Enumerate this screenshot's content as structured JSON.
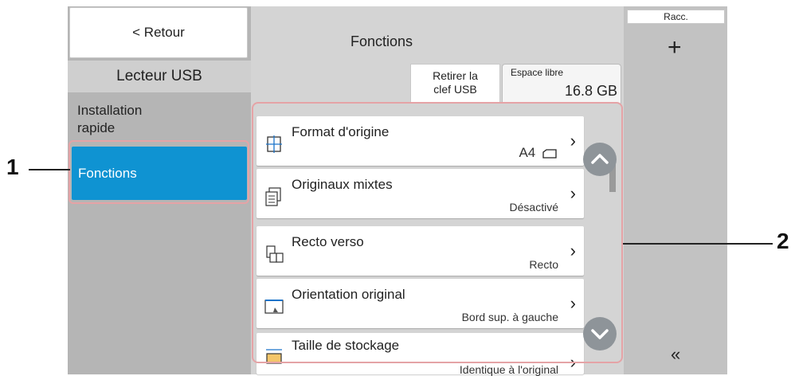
{
  "sidebar": {
    "back_label": "< Retour",
    "section_title": "Lecteur USB",
    "items": [
      {
        "label": "Installation\nrapide"
      },
      {
        "label": "Fonctions"
      }
    ]
  },
  "main": {
    "title": "Fonctions",
    "tab_remove_label": "Retirer la\nclef USB",
    "space_label": "Espace libre",
    "space_value": "16.8 GB",
    "rows": [
      {
        "title": "Format d'origine",
        "value": "A4",
        "icon": "original-size-icon"
      },
      {
        "title": "Originaux mixtes",
        "value": "Désactivé",
        "icon": "mixed-originals-icon"
      },
      {
        "title": "Recto verso",
        "value": "Recto",
        "icon": "duplex-icon"
      },
      {
        "title": "Orientation original",
        "value": "Bord sup. à gauche",
        "icon": "orientation-icon"
      },
      {
        "title": "Taille de stockage",
        "value": "Identique à l'original",
        "icon": "storage-size-icon"
      }
    ]
  },
  "right_panel": {
    "shortcut_label": "Racc.",
    "plus": "+",
    "collapse": "«"
  },
  "callouts": {
    "one": "1",
    "two": "2"
  },
  "colors": {
    "selected_blue": "#0f93d2",
    "highlight_outline": "#e5a3a6"
  }
}
